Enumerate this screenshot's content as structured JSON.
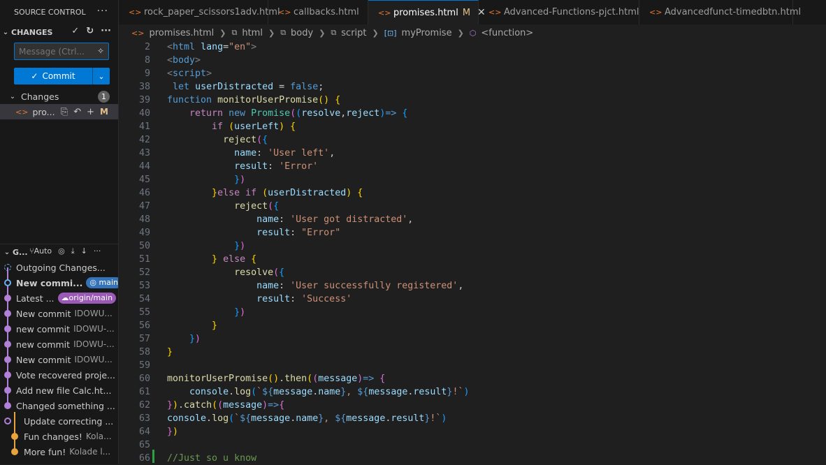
{
  "sidebar": {
    "title": "SOURCE CONTROL",
    "changes_header": "CHANGES",
    "message_placeholder": "Message (Ctrl...",
    "commit_label": "Commit",
    "changes_label": "Changes",
    "changes_count": "1",
    "file": {
      "name": "pro...",
      "status": "M"
    },
    "graph_header": "G...",
    "graph_auto": "Auto",
    "graph_items": [
      {
        "title": "Outgoing Changes...",
        "author": ""
      },
      {
        "title": "New commi...",
        "author": "",
        "tag": "main"
      },
      {
        "title": "Latest ...",
        "author": "",
        "tag": "origin/main"
      },
      {
        "title": "New commit",
        "author": "IDOWU..."
      },
      {
        "title": "new commit",
        "author": "IDOWU-..."
      },
      {
        "title": "new commit",
        "author": "IDOWU-..."
      },
      {
        "title": "New commit",
        "author": "IDOWU..."
      },
      {
        "title": "Vote recovered proje...",
        "author": ""
      },
      {
        "title": "Add new file Calc.ht...",
        "author": ""
      },
      {
        "title": "Changed something ...",
        "author": ""
      },
      {
        "title": "Update correcting ...",
        "author": ""
      },
      {
        "title": "Fun changes!",
        "author": "Kola..."
      },
      {
        "title": "More fun!",
        "author": "Kolade l..."
      }
    ]
  },
  "tabs": [
    {
      "label": "rock_paper_scissors1adv.html"
    },
    {
      "label": "callbacks.html"
    },
    {
      "label": "promises.html",
      "modified": "M"
    },
    {
      "label": "Advanced-Functions-pjct.html"
    },
    {
      "label": "Advancedfunct-timedbtn.html"
    }
  ],
  "breadcrumbs": [
    "promises.html",
    "html",
    "body",
    "script",
    "myPromise",
    "<function>"
  ],
  "editor": {
    "line_numbers": [
      "2",
      "8",
      "9",
      "38",
      "39",
      "40",
      "41",
      "42",
      "43",
      "44",
      "45",
      "46",
      "47",
      "48",
      "49",
      "50",
      "51",
      "52",
      "53",
      "54",
      "55",
      "56",
      "57",
      "58",
      "59",
      "60",
      "61",
      "62",
      "63",
      "64",
      "65",
      "66"
    ]
  }
}
